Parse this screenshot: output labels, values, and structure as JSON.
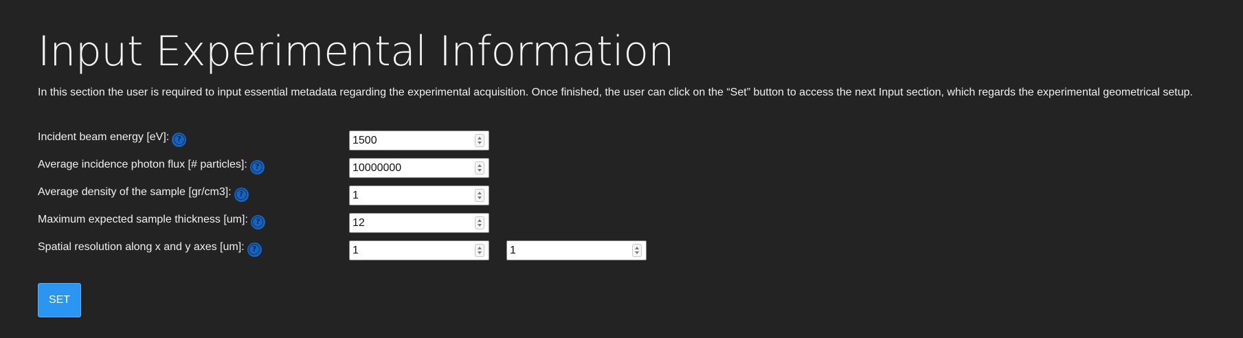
{
  "page": {
    "title": "Input Experimental Information",
    "description": "In this section the user is required to input essential metadata regarding the experimental acquisition. Once finished, the user can click on the “Set” button to access the next Input section, which regards the experimental geometrical setup."
  },
  "fields": [
    {
      "label": "Incident beam energy [eV]:",
      "values": [
        "1500"
      ]
    },
    {
      "label": "Average incidence photon flux [# particles]:",
      "values": [
        "10000000"
      ]
    },
    {
      "label": "Average density of the sample [gr/cm3]:",
      "values": [
        "1"
      ]
    },
    {
      "label": "Maximum expected sample thickness [um]:",
      "values": [
        "12"
      ]
    },
    {
      "label": "Spatial resolution along x and y axes [um]:",
      "values": [
        "1",
        "1"
      ]
    }
  ],
  "help_icon": {
    "icon": "question-circle-icon",
    "glyph": "?",
    "color": "#1565c0"
  },
  "actions": {
    "set_label": "SET",
    "set_color": "#2b96f2"
  },
  "theme": {
    "background": "#232323",
    "text": "#ffffff"
  }
}
